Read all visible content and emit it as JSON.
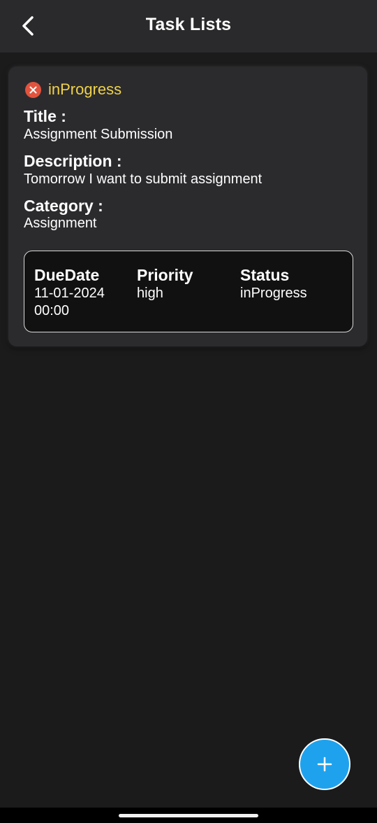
{
  "app_bar": {
    "title": "Task Lists",
    "back_icon": "chevron-left-icon"
  },
  "task": {
    "status_icon": "close-circle-icon",
    "status_color": "#f0d24a",
    "status_label": "inProgress",
    "title_label": "Title :",
    "title_value": "Assignment Submission",
    "description_label": "Description :",
    "description_value": "Tomorrow I want to submit assignment",
    "category_label": "Category :",
    "category_value": "Assignment",
    "details": {
      "due_date_label": "DueDate",
      "due_date_value": "11-01-2024",
      "due_time_value": "00:00",
      "priority_label": "Priority",
      "priority_value": "high",
      "status_label": "Status",
      "status_value": "inProgress"
    }
  },
  "fab": {
    "icon": "plus-icon",
    "color": "#1ea2ee"
  }
}
